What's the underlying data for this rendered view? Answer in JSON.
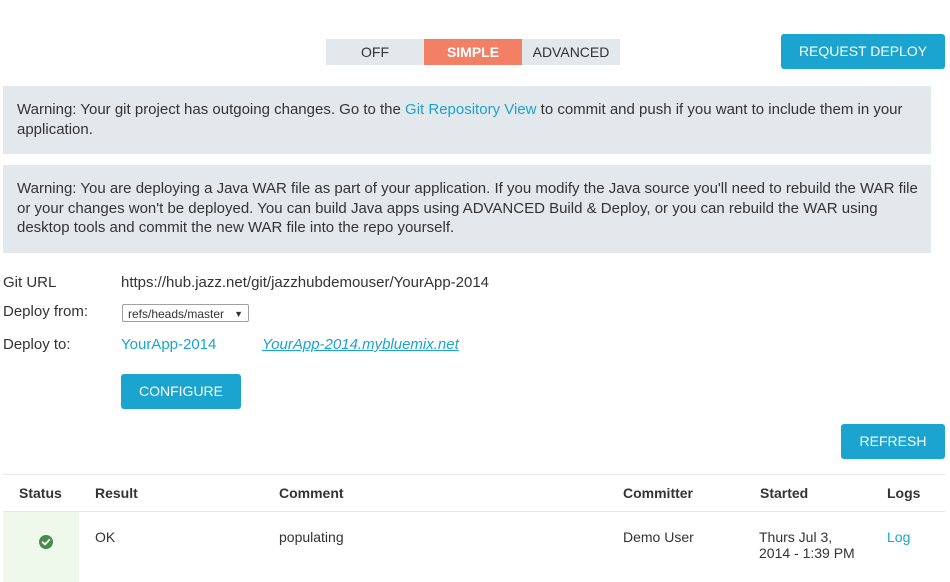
{
  "mode": {
    "off": "OFF",
    "simple": "SIMPLE",
    "advanced": "ADVANCED"
  },
  "actions": {
    "request_deploy": "REQUEST DEPLOY",
    "configure": "CONFIGURE",
    "refresh": "REFRESH"
  },
  "warnings": {
    "git_prefix": "Warning: Your git project has outgoing changes. Go to the ",
    "git_link": "Git Repository View",
    "git_suffix": " to commit and push if you want to include them in your application.",
    "war": "Warning: You are deploying a Java WAR file as part of your application. If you modify the Java source you'll need to rebuild the WAR file or your changes won't be deployed. You can build Java apps using ADVANCED Build & Deploy, or you can rebuild the WAR using desktop tools and commit the new WAR file into the repo yourself."
  },
  "fields": {
    "git_url_label": "Git URL",
    "git_url_value": "https://hub.jazz.net/git/jazzhubdemouser/YourApp-2014",
    "deploy_from_label": "Deploy from:",
    "deploy_from_value": "refs/heads/master",
    "deploy_to_label": "Deploy to:",
    "deploy_to_app": "YourApp-2014",
    "deploy_to_url": "YourApp-2014.mybluemix.net"
  },
  "table": {
    "headers": {
      "status": "Status",
      "result": "Result",
      "comment": "Comment",
      "committer": "Committer",
      "started": "Started",
      "logs": "Logs"
    },
    "rows": [
      {
        "status": "success",
        "result": "OK",
        "comment": "populating",
        "committer": "Demo User",
        "started_line1": "Thurs Jul 3,",
        "started_line2": "2014 - 1:39 PM",
        "log": "Log"
      }
    ]
  },
  "colors": {
    "accent": "#1aa4cf",
    "mode_active": "#f37f64",
    "warning_bg": "#e3e8ec",
    "success": "#4a8a4a"
  }
}
